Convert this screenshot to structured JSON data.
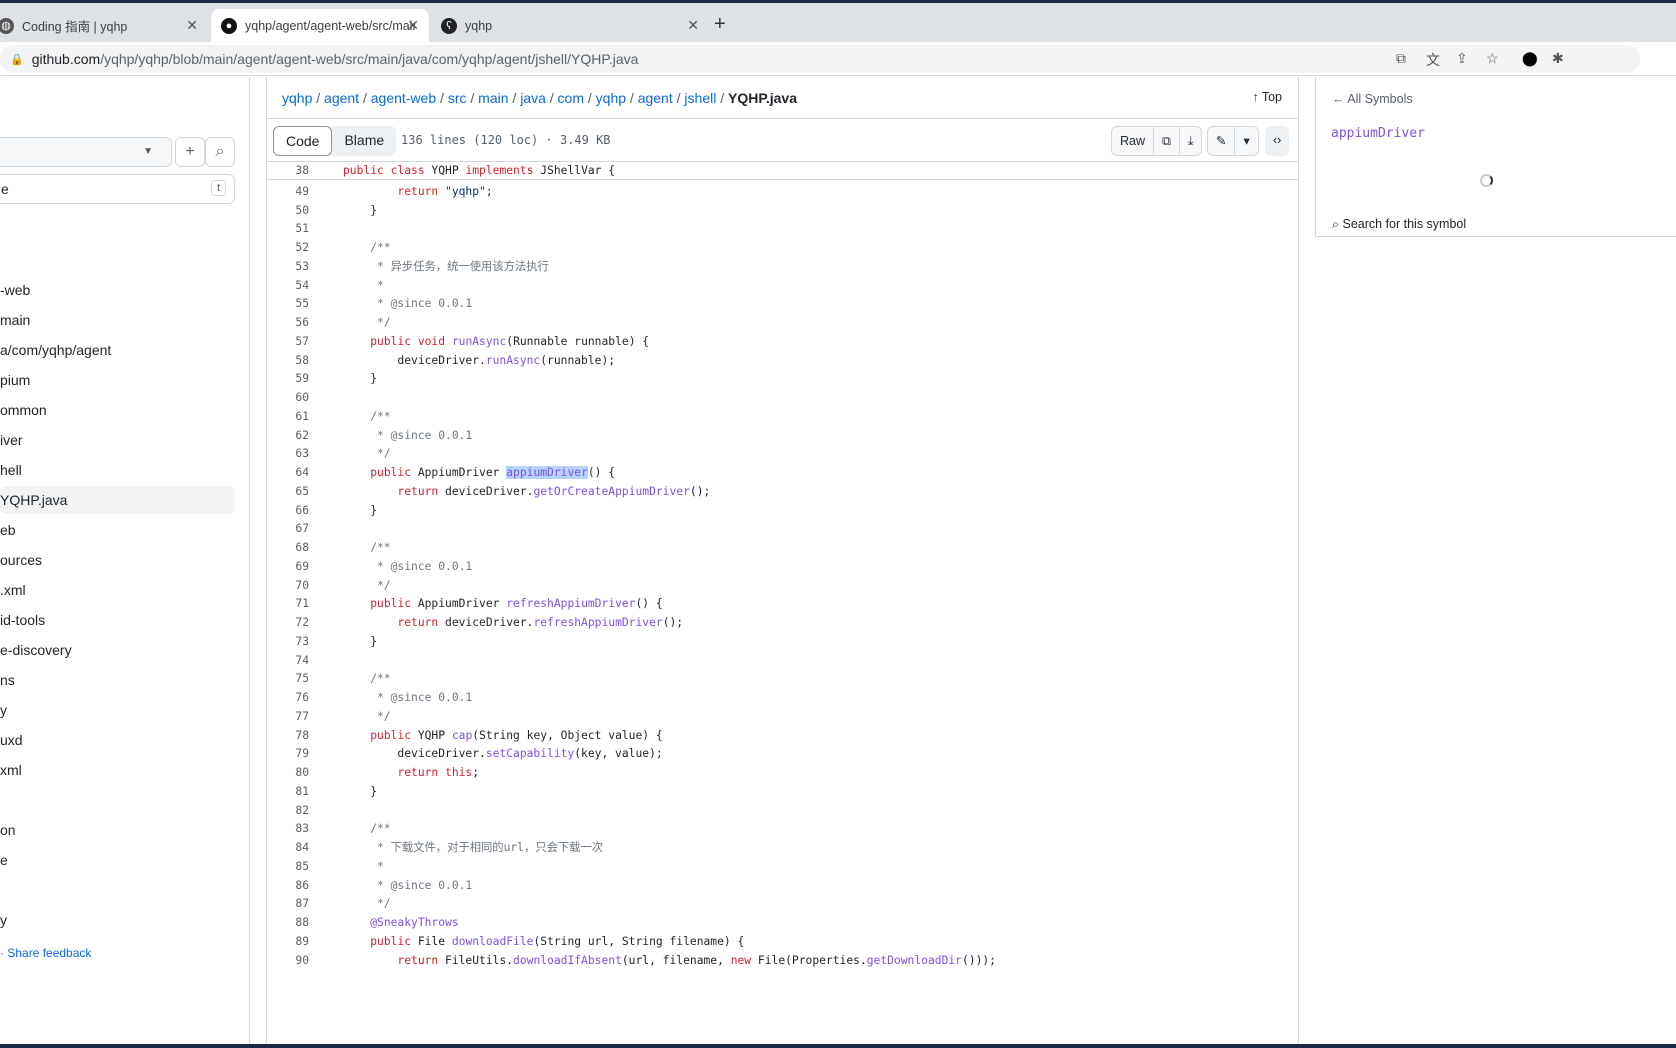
{
  "browser": {
    "tabs": [
      {
        "title": "Coding 指南 | yqhp",
        "icon": "globe-icon"
      },
      {
        "title": "yqhp/agent/agent-web/src/main/java",
        "icon": "github-icon"
      },
      {
        "title": "yqhp",
        "icon": "bear-icon"
      }
    ],
    "url_host": "github.com",
    "url_path": "/yqhp/yqhp/blob/main/agent/agent-web/src/main/java/com/yqhp/agent/jshell/YQHP.java"
  },
  "sidebar": {
    "filter_value": "e",
    "filter_shortcut": "t",
    "items": [
      "-web",
      "main",
      "a/com/yqhp/agent",
      "pium",
      "ommon",
      "iver",
      "hell",
      "YQHP.java",
      "eb",
      "ources",
      ".xml",
      "id-tools",
      "e-discovery",
      "ns",
      "y",
      "uxd",
      "xml",
      "",
      "on",
      "e",
      "",
      "y"
    ],
    "selected_index": 7,
    "feedback": "Share feedback"
  },
  "main": {
    "breadcrumb": [
      "yqhp",
      "agent",
      "agent-web",
      "src",
      "main",
      "java",
      "com",
      "yqhp",
      "agent",
      "jshell"
    ],
    "file": "YQHP.java",
    "top": "Top",
    "tabs": [
      "Code",
      "Blame"
    ],
    "meta": "136 lines (120 loc) · 3.49 KB",
    "raw": "Raw",
    "sticky": {
      "n": "38",
      "tokens": [
        [
          "k",
          "public class "
        ],
        [
          "p",
          "YQHP "
        ],
        [
          "k",
          "implements "
        ],
        [
          "p",
          "JShellVar {"
        ]
      ]
    },
    "lines": [
      {
        "n": "49",
        "tokens": [
          [
            "p",
            "        "
          ],
          [
            "k",
            "return "
          ],
          [
            "s",
            "\"yqhp\""
          ],
          [
            "p",
            ";"
          ]
        ]
      },
      {
        "n": "50",
        "tokens": [
          [
            "p",
            "    }"
          ]
        ]
      },
      {
        "n": "51",
        "tokens": []
      },
      {
        "n": "52",
        "tokens": [
          [
            "c",
            "    /**"
          ]
        ]
      },
      {
        "n": "53",
        "tokens": [
          [
            "c",
            "     * 异步任务，统一使用该方法执行"
          ]
        ]
      },
      {
        "n": "54",
        "tokens": [
          [
            "c",
            "     *"
          ]
        ]
      },
      {
        "n": "55",
        "tokens": [
          [
            "c",
            "     * @since 0.0.1"
          ]
        ]
      },
      {
        "n": "56",
        "tokens": [
          [
            "c",
            "     */"
          ]
        ]
      },
      {
        "n": "57",
        "tokens": [
          [
            "p",
            "    "
          ],
          [
            "k",
            "public void "
          ],
          [
            "f",
            "runAsync"
          ],
          [
            "p",
            "(Runnable runnable) {"
          ]
        ]
      },
      {
        "n": "58",
        "tokens": [
          [
            "p",
            "        deviceDriver."
          ],
          [
            "f",
            "runAsync"
          ],
          [
            "p",
            "(runnable);"
          ]
        ]
      },
      {
        "n": "59",
        "tokens": [
          [
            "p",
            "    }"
          ]
        ]
      },
      {
        "n": "60",
        "tokens": []
      },
      {
        "n": "61",
        "tokens": [
          [
            "c",
            "    /**"
          ]
        ]
      },
      {
        "n": "62",
        "tokens": [
          [
            "c",
            "     * @since 0.0.1"
          ]
        ]
      },
      {
        "n": "63",
        "tokens": [
          [
            "c",
            "     */"
          ]
        ]
      },
      {
        "n": "64",
        "tokens": [
          [
            "p",
            "    "
          ],
          [
            "k",
            "public "
          ],
          [
            "p",
            "AppiumDriver "
          ],
          [
            "h",
            "appiumDriver"
          ],
          [
            "p",
            "() {"
          ]
        ]
      },
      {
        "n": "65",
        "tokens": [
          [
            "p",
            "        "
          ],
          [
            "k",
            "return "
          ],
          [
            "p",
            "deviceDriver."
          ],
          [
            "f",
            "getOrCreateAppiumDriver"
          ],
          [
            "p",
            "();"
          ]
        ]
      },
      {
        "n": "66",
        "tokens": [
          [
            "p",
            "    }"
          ]
        ]
      },
      {
        "n": "67",
        "tokens": []
      },
      {
        "n": "68",
        "tokens": [
          [
            "c",
            "    /**"
          ]
        ]
      },
      {
        "n": "69",
        "tokens": [
          [
            "c",
            "     * @since 0.0.1"
          ]
        ]
      },
      {
        "n": "70",
        "tokens": [
          [
            "c",
            "     */"
          ]
        ]
      },
      {
        "n": "71",
        "tokens": [
          [
            "p",
            "    "
          ],
          [
            "k",
            "public "
          ],
          [
            "p",
            "AppiumDriver "
          ],
          [
            "f",
            "refreshAppiumDriver"
          ],
          [
            "p",
            "() {"
          ]
        ]
      },
      {
        "n": "72",
        "tokens": [
          [
            "p",
            "        "
          ],
          [
            "k",
            "return "
          ],
          [
            "p",
            "deviceDriver."
          ],
          [
            "f",
            "refreshAppiumDriver"
          ],
          [
            "p",
            "();"
          ]
        ]
      },
      {
        "n": "73",
        "tokens": [
          [
            "p",
            "    }"
          ]
        ]
      },
      {
        "n": "74",
        "tokens": []
      },
      {
        "n": "75",
        "tokens": [
          [
            "c",
            "    /**"
          ]
        ]
      },
      {
        "n": "76",
        "tokens": [
          [
            "c",
            "     * @since 0.0.1"
          ]
        ]
      },
      {
        "n": "77",
        "tokens": [
          [
            "c",
            "     */"
          ]
        ]
      },
      {
        "n": "78",
        "tokens": [
          [
            "p",
            "    "
          ],
          [
            "k",
            "public "
          ],
          [
            "p",
            "YQHP "
          ],
          [
            "f",
            "cap"
          ],
          [
            "p",
            "(String key, Object value) {"
          ]
        ]
      },
      {
        "n": "79",
        "tokens": [
          [
            "p",
            "        deviceDriver."
          ],
          [
            "f",
            "setCapability"
          ],
          [
            "p",
            "(key, value);"
          ]
        ]
      },
      {
        "n": "80",
        "tokens": [
          [
            "p",
            "        "
          ],
          [
            "k",
            "return this"
          ],
          [
            "p",
            ";"
          ]
        ]
      },
      {
        "n": "81",
        "tokens": [
          [
            "p",
            "    }"
          ]
        ]
      },
      {
        "n": "82",
        "tokens": []
      },
      {
        "n": "83",
        "tokens": [
          [
            "c",
            "    /**"
          ]
        ]
      },
      {
        "n": "84",
        "tokens": [
          [
            "c",
            "     * 下载文件，对于相同的url，只会下载一次"
          ]
        ]
      },
      {
        "n": "85",
        "tokens": [
          [
            "c",
            "     *"
          ]
        ]
      },
      {
        "n": "86",
        "tokens": [
          [
            "c",
            "     * @since 0.0.1"
          ]
        ]
      },
      {
        "n": "87",
        "tokens": [
          [
            "c",
            "     */"
          ]
        ]
      },
      {
        "n": "88",
        "tokens": [
          [
            "p",
            "    "
          ],
          [
            "f",
            "@SneakyThrows"
          ]
        ]
      },
      {
        "n": "89",
        "tokens": [
          [
            "p",
            "    "
          ],
          [
            "k",
            "public "
          ],
          [
            "p",
            "File "
          ],
          [
            "f",
            "downloadFile"
          ],
          [
            "p",
            "(String url, String filename) {"
          ]
        ]
      },
      {
        "n": "90",
        "tokens": [
          [
            "p",
            "        "
          ],
          [
            "k",
            "return "
          ],
          [
            "p",
            "FileUtils."
          ],
          [
            "f",
            "downloadIfAbsent"
          ],
          [
            "p",
            "(url, filename, "
          ],
          [
            "k",
            "new "
          ],
          [
            "p",
            "File(Properties."
          ],
          [
            "f",
            "getDownloadDir"
          ],
          [
            "p",
            "()));"
          ]
        ]
      }
    ]
  },
  "symbols": {
    "back": "All Symbols",
    "name": "appiumDriver",
    "search": "Search for this symbol"
  }
}
